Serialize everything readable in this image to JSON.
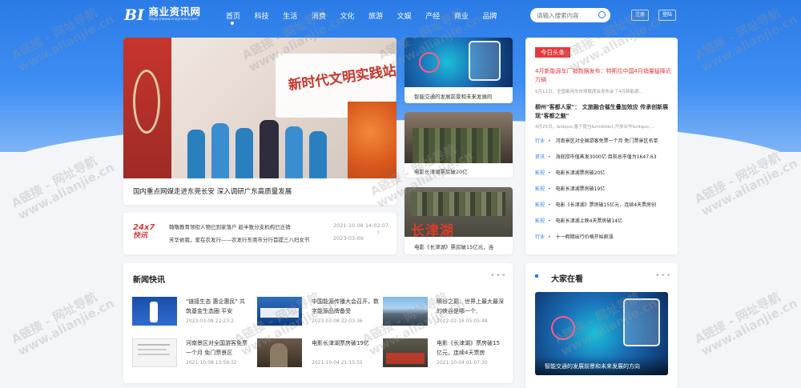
{
  "logo": {
    "mark": "BI",
    "title": "商业资讯网",
    "url": "https://www.cnsynews.com"
  },
  "nav": [
    "首页",
    "科技",
    "生活",
    "消费",
    "文化",
    "旅游",
    "文娱",
    "产经",
    "商业",
    "品牌"
  ],
  "search": {
    "placeholder": "请输入搜索内容"
  },
  "header_buttons": {
    "register": "注册",
    "login": "登陆"
  },
  "watermark": {
    "line1": "A链接 - 网址导航",
    "line2": "www.alianjie.cn"
  },
  "hero": {
    "caption": "国内重点网媒走进东莞长安 深入调研广东高质量发展",
    "banner_text": "新时代文明实践站"
  },
  "ticker": {
    "logo_top": "24x7",
    "logo_bottom": "快讯",
    "items": [
      {
        "text": "翰敬教育领衔人物已到家落户 趁半数分支机构已迁销",
        "date": "2021-10-08 14:02:07"
      },
      {
        "text": "芳华依我，爱在农发行——农发行东莞市分行首提三八妇女节",
        "date": "2023-03-09"
      }
    ]
  },
  "mid_cards": [
    {
      "caption": "智能交通的发展前景和未来发展的"
    },
    {
      "caption": "电影长津湖票房破20亿"
    },
    {
      "caption": "电影《长津湖》票房破15亿元，连",
      "poster_title": "长津湖"
    }
  ],
  "today": {
    "badge": "今日头条",
    "headline1": "4月新能源车厂销数据发布：特斯拉中国4月销量猛降近万辆",
    "summary1": "5月11日，全国乘用车市场联席会发布会了4月新能源...",
    "headline2": "柳州\"客都人家\"： 文旅融合催生叠加效应 传承创新展现\"客都之魅\"",
    "summary2": "4月25日，&ldquo;善于提当&mldddot;开放合作&rdquo;...",
    "list": [
      {
        "tag": "行业",
        "text": "河南景区对全国游客免票一个月 免门票景区名单"
      },
      {
        "tag": "资讯",
        "text": "海底捞市值蒸发3000亿 目前总市值为1647.63"
      },
      {
        "tag": "影视",
        "text": "电影长津湖票房破20亿"
      },
      {
        "tag": "影视",
        "text": "电影长津湖票房破19亿"
      },
      {
        "tag": "影视",
        "text": "电影《长津湖》票房破15亿元，连续4天票房创"
      },
      {
        "tag": "影视",
        "text": "电影长津湖上映4天票房破14亿"
      },
      {
        "tag": "行业",
        "text": "十一假期出行价格开始疯涨"
      }
    ]
  },
  "news": {
    "title": "新闻快讯",
    "more": "•••",
    "items": [
      {
        "title": "\"链接生态 惠企惠民\" 共筑基金生态圈 平安",
        "date": "2023-03-08 22:23:2"
      },
      {
        "title": "中国能源传播大会召开，数字能源品牌备受",
        "date": "2023-03-08 22:03:36"
      },
      {
        "title": "瞬谷之巅：世界上最大最深的峡谷是哪一个,",
        "date": "2022-02-16 05:05:48"
      },
      {
        "title": "河南景区对全国游客免票一个月 免门票景区",
        "date": "2021-10-08 13:59:32"
      },
      {
        "title": "电影长津湖票房破19亿",
        "date": "2021-10-04 21:15:55"
      },
      {
        "title": "电影《长津湖》票房破15亿元，连续4天票房",
        "date": "2021-10-04 01:07:30"
      }
    ]
  },
  "popular": {
    "title": "大家在看",
    "more": "•••",
    "caption": "智能交通的发展前景和未来发展的方向"
  },
  "colors": {
    "brand": "#2b7be6",
    "badge": "#e8383d",
    "headline": "#e8383d"
  }
}
